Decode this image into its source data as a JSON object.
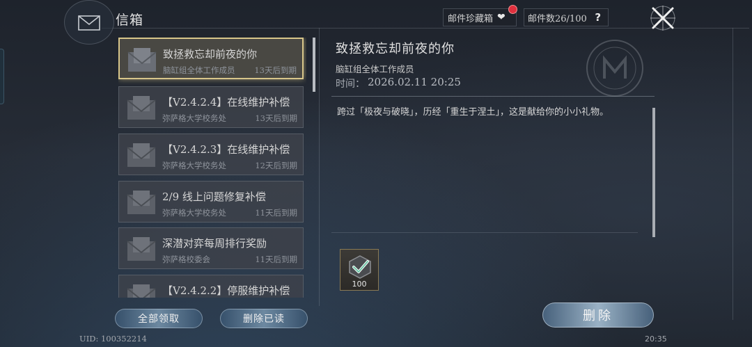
{
  "header": {
    "title": "信箱",
    "collection_label": "邮件珍藏箱",
    "mail_count_label": "邮件数26/100",
    "help_glyph": "?"
  },
  "mail_list": [
    {
      "title": "致拯救忘却前夜的你",
      "sender": "脑缸组全体工作成员",
      "expiry": "13天后到期",
      "selected": true
    },
    {
      "title": "【V2.4.2.4】在线维护补偿",
      "sender": "弥萨格大学校务处",
      "expiry": "13天后到期",
      "selected": false
    },
    {
      "title": "【V2.4.2.3】在线维护补偿",
      "sender": "弥萨格大学校务处",
      "expiry": "12天后到期",
      "selected": false
    },
    {
      "title": "2/9 线上问题修复补偿",
      "sender": "弥萨格大学校务处",
      "expiry": "11天后到期",
      "selected": false
    },
    {
      "title": "深潜对弈每周排行奖励",
      "sender": "弥萨格校委会",
      "expiry": "11天后到期",
      "selected": false
    },
    {
      "title": "【V2.4.2.2】停服维护补偿",
      "sender": "",
      "expiry": "",
      "selected": false
    }
  ],
  "buttons": {
    "claim_all": "全部领取",
    "delete_read": "删除已读",
    "delete": "删除"
  },
  "detail": {
    "title": "致拯救忘却前夜的你",
    "sender": "脑缸组全体工作成员",
    "time_label": "时间：",
    "time_value": "2026.02.11 20:25",
    "body": "跨过「极夜与破晓」，历经「重生于涅土」，这是献给你的小小礼物。",
    "attachment": {
      "quantity": "100",
      "icon": "claimed-item-icon"
    }
  },
  "footer": {
    "uid": "UID: 100352214",
    "clock": "20:35"
  },
  "colors": {
    "selected_border": "#d8c68a",
    "notification_dot": "#e0303e"
  }
}
